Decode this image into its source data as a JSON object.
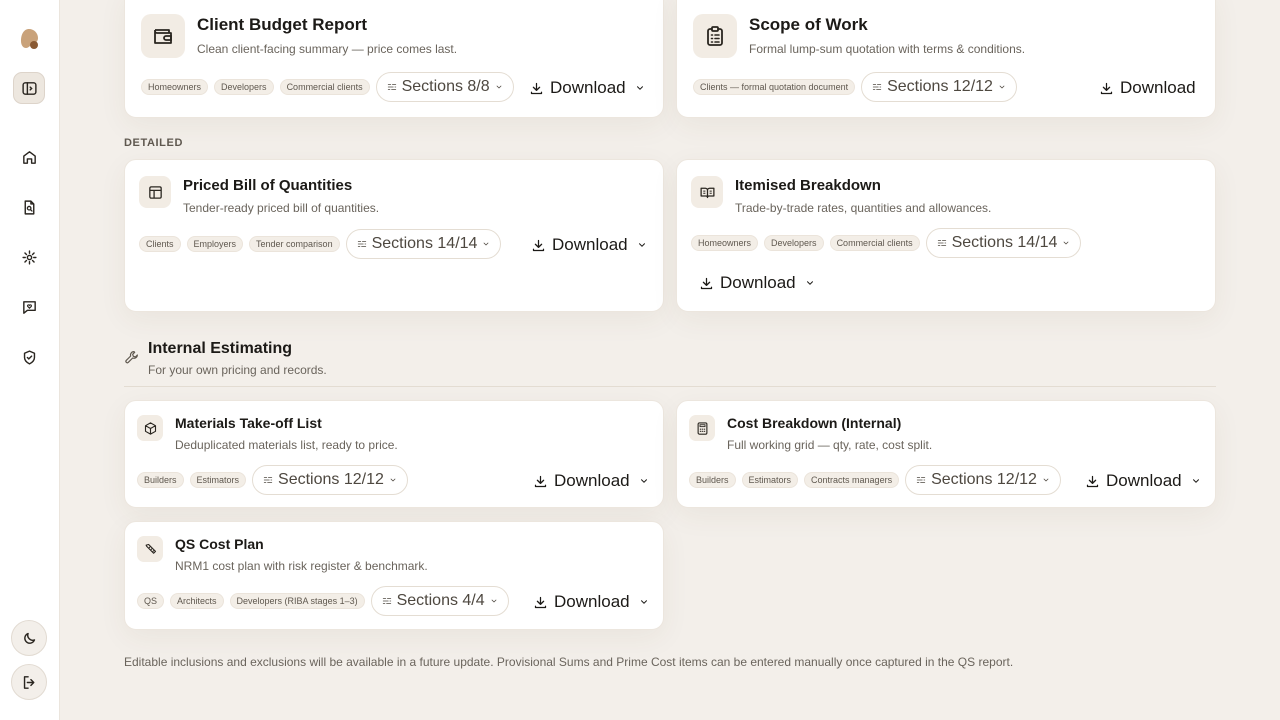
{
  "sidebar": {
    "logo": "brand-logo",
    "items": [
      {
        "name": "home",
        "icon": "home-icon"
      },
      {
        "name": "reports",
        "icon": "file-search-icon"
      },
      {
        "name": "settings",
        "icon": "gear-icon"
      },
      {
        "name": "feedback",
        "icon": "chat-heart-icon"
      },
      {
        "name": "security",
        "icon": "shield-check-icon"
      }
    ],
    "bottom": [
      {
        "name": "theme",
        "icon": "moon-icon"
      },
      {
        "name": "logout",
        "icon": "logout-icon"
      }
    ]
  },
  "client_cards": [
    {
      "title": "Client Budget Report",
      "description": "Clean client-facing summary — price comes last.",
      "icon": "wallet-icon",
      "tags": [
        "Homeowners",
        "Developers",
        "Commercial clients"
      ],
      "sections": "Sections 8/8",
      "download": "Download",
      "has_dropdown": true
    },
    {
      "title": "Scope of Work",
      "description": "Formal lump-sum quotation with terms & conditions.",
      "icon": "clipboard-list-icon",
      "tags": [
        "Clients — formal quotation document"
      ],
      "sections": "Sections 12/12",
      "download": "Download",
      "has_dropdown": false
    }
  ],
  "detailed": {
    "label": "DETAILED",
    "cards": [
      {
        "title": "Priced Bill of Quantities",
        "description": "Tender-ready priced bill of quantities.",
        "icon": "table-icon",
        "tags": [
          "Clients",
          "Employers",
          "Tender comparison"
        ],
        "sections": "Sections 14/14",
        "download": "Download"
      },
      {
        "title": "Itemised Breakdown",
        "description": "Trade-by-trade rates, quantities and allowances.",
        "icon": "book-open-icon",
        "tags": [
          "Homeowners",
          "Developers",
          "Commercial clients"
        ],
        "sections": "Sections 14/14",
        "download": "Download"
      }
    ]
  },
  "internal": {
    "title": "Internal Estimating",
    "subtitle": "For your own pricing and records.",
    "icon": "wrench-icon",
    "cards": [
      {
        "title": "Materials Take-off List",
        "description": "Deduplicated materials list, ready to price.",
        "icon": "box-icon",
        "tags": [
          "Builders",
          "Estimators"
        ],
        "sections": "Sections 12/12",
        "download": "Download"
      },
      {
        "title": "Cost Breakdown (Internal)",
        "description": "Full working grid — qty, rate, cost split.",
        "icon": "calculator-icon",
        "tags": [
          "Builders",
          "Estimators",
          "Contracts managers"
        ],
        "sections": "Sections 12/12",
        "download": "Download"
      },
      {
        "title": "QS Cost Plan",
        "description": "NRM1 cost plan with risk register & benchmark.",
        "icon": "ruler-pencil-icon",
        "tags": [
          "QS",
          "Architects",
          "Developers (RIBA stages 1–3)"
        ],
        "sections": "Sections 4/4",
        "download": "Download"
      }
    ]
  },
  "footnote": "Editable inclusions and exclusions will be available in a future update. Provisional Sums and Prime Cost items can be entered manually once captured in the QS report."
}
